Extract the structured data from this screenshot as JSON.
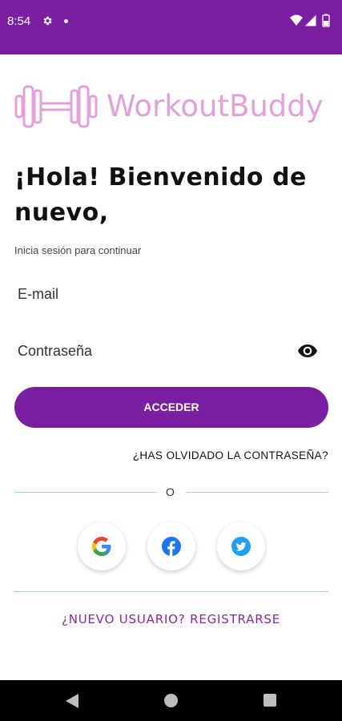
{
  "status_bar": {
    "time": "8:54",
    "icons": [
      "settings-gear-icon",
      "notification-dot-icon",
      "wifi-icon",
      "signal-icon",
      "battery-icon"
    ],
    "background_color": "#7b1fa2"
  },
  "logo": {
    "icon": "dumbbell-icon",
    "text": "WorkoutBuddy",
    "color": "#e4a0db"
  },
  "headline": "¡Hola! Bienvenido de nuevo,",
  "subtitle": "Inicia sesión para continuar",
  "form": {
    "email_label": "E-mail",
    "password_label": "Contraseña",
    "password_toggle_icon": "eye-icon",
    "login_button": "ACCEDER",
    "forgot_password": "¿HAS OLVIDADO LA CONTRASEÑA?"
  },
  "divider_text": "O",
  "social": [
    {
      "name": "google",
      "icon": "google-icon"
    },
    {
      "name": "facebook",
      "icon": "facebook-icon",
      "color": "#1877f2"
    },
    {
      "name": "twitter",
      "icon": "twitter-icon",
      "color": "#1da1f2"
    }
  ],
  "register_link": "¿NUEVO USUARIO? REGISTRARSE",
  "colors": {
    "primary": "#7b1fa2",
    "accent_text": "#8e24aa",
    "divider": "#9dd3e4"
  },
  "nav_bar": {
    "icons": [
      "back-icon",
      "home-icon",
      "recents-icon"
    ]
  }
}
